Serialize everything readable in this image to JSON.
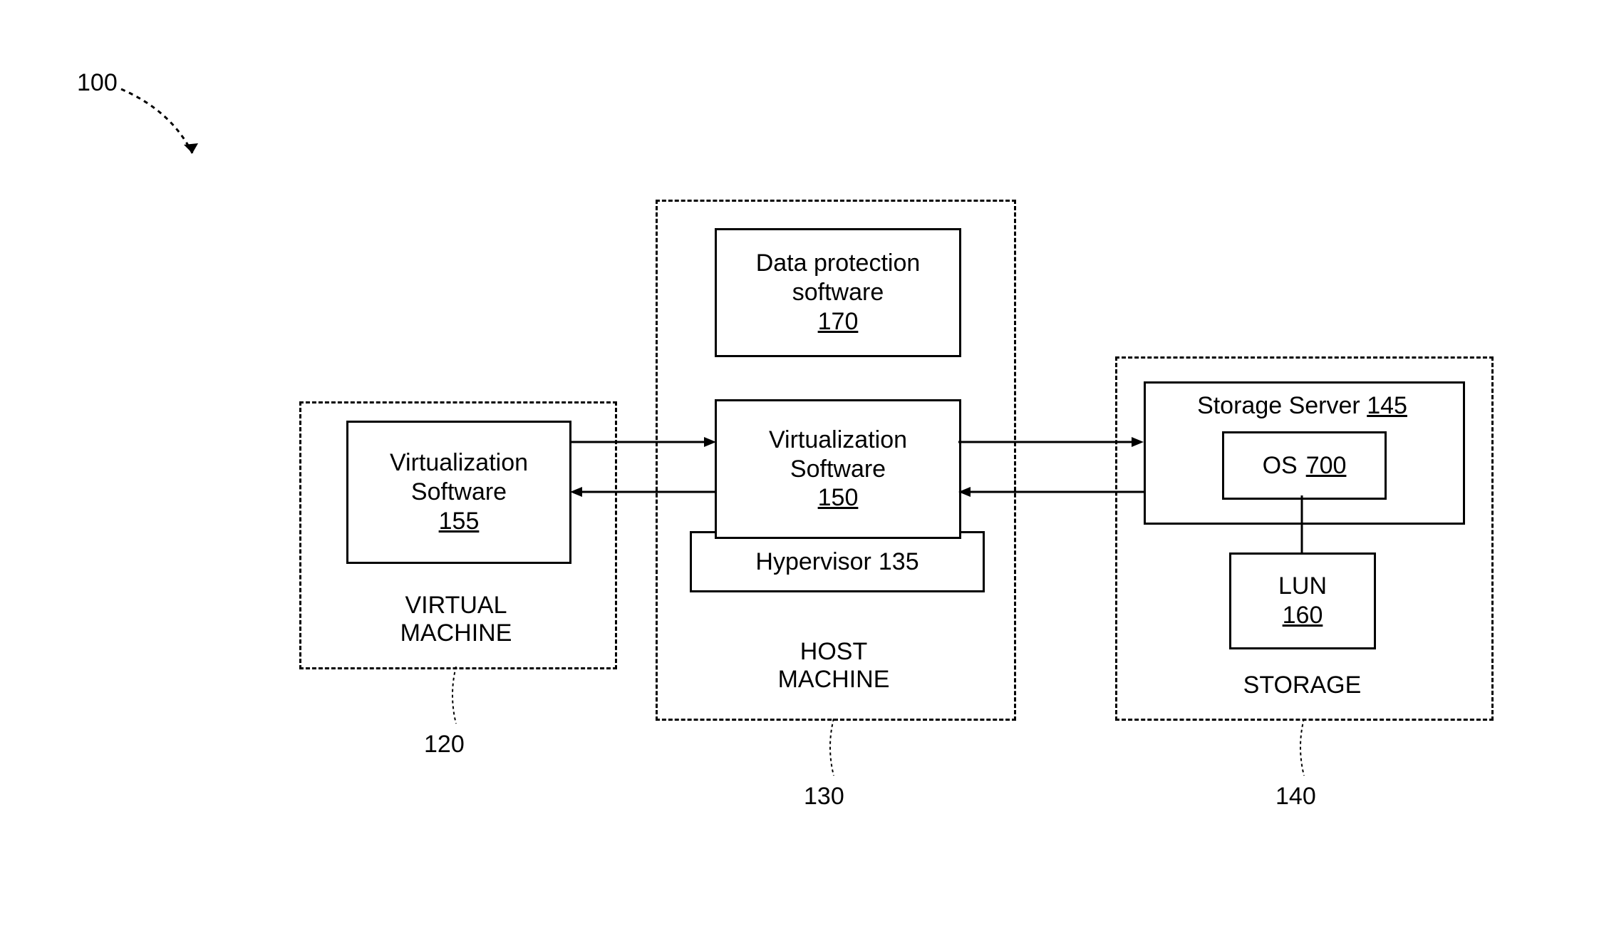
{
  "figure_ref": "100",
  "virtual_machine": {
    "title_line1": "VIRTUAL",
    "title_line2": "MACHINE",
    "ref": "120",
    "virt_sw": {
      "line1": "Virtualization",
      "line2": "Software",
      "num": "155"
    }
  },
  "host_machine": {
    "title_line1": "HOST",
    "title_line2": "MACHINE",
    "ref": "130",
    "data_protection": {
      "line1": "Data protection",
      "line2": "software",
      "num": "170"
    },
    "virt_sw": {
      "line1": "Virtualization",
      "line2": "Software",
      "num": "150"
    },
    "hypervisor": {
      "label": "Hypervisor",
      "num": "135"
    }
  },
  "storage": {
    "title": "STORAGE",
    "ref": "140",
    "server": {
      "label": "Storage Server",
      "num": "145"
    },
    "os": {
      "label": "OS",
      "num": "700"
    },
    "lun": {
      "label": "LUN",
      "num": "160"
    }
  }
}
